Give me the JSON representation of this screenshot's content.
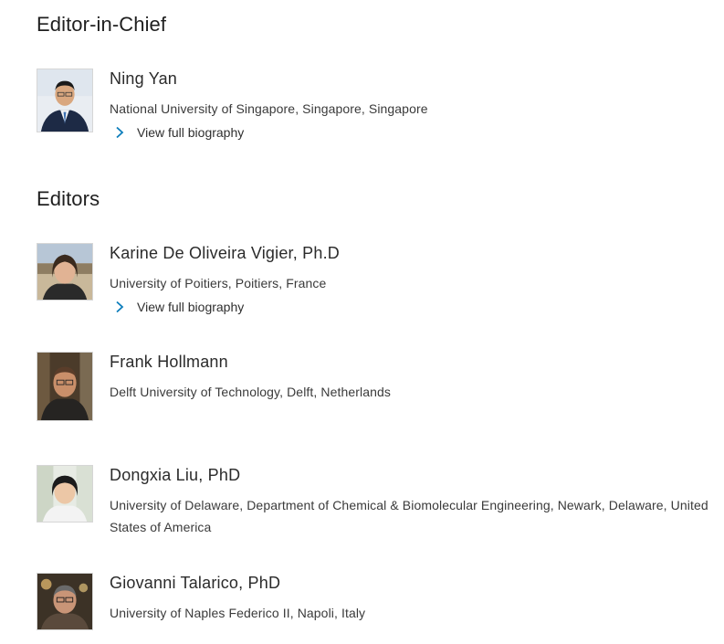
{
  "editor_in_chief": {
    "heading": "Editor-in-Chief",
    "people": [
      {
        "name": "Ning Yan",
        "affiliation": "National University of Singapore, Singapore, Singapore",
        "bio_link": "View full biography",
        "icon": "chevron-right-icon"
      }
    ]
  },
  "editors": {
    "heading": "Editors",
    "people": [
      {
        "name": "Karine De Oliveira Vigier, Ph.D",
        "affiliation": "University of Poitiers, Poitiers, France",
        "bio_link": "View full biography",
        "icon": "chevron-right-icon"
      },
      {
        "name": "Frank Hollmann",
        "affiliation": "Delft University of Technology, Delft, Netherlands"
      },
      {
        "name": "Dongxia Liu, PhD",
        "affiliation": "University of Delaware, Department of Chemical & Biomolecular Engineering, Newark, Delaware, United States of America"
      },
      {
        "name": "Giovanni Talarico, PhD",
        "affiliation": "University of Naples Federico II, Napoli, Italy"
      }
    ]
  },
  "colors": {
    "link_chevron": "#0c7dbb",
    "text": "#2e2e2e"
  }
}
